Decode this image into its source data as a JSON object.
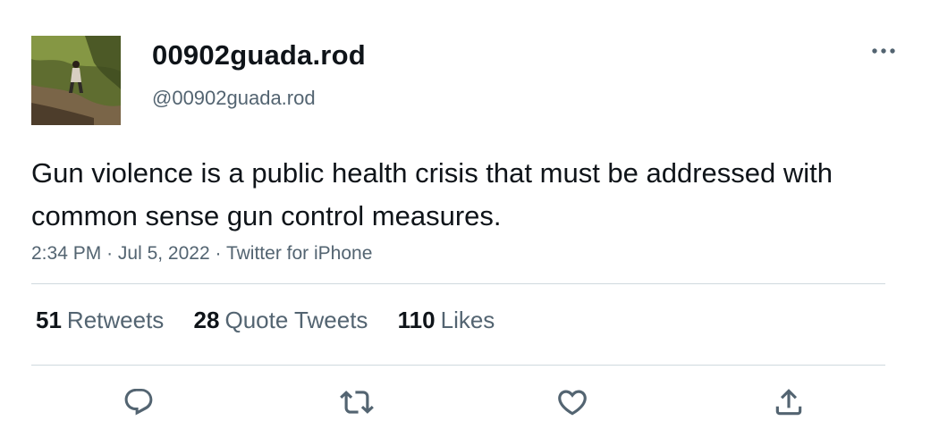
{
  "author": {
    "display_name": "00902guada.rod",
    "handle": "@00902guada.rod",
    "avatar_icon": "profile-photo-person-on-trail"
  },
  "tweet": {
    "text": "Gun violence is a public health crisis that must be addressed with common sense gun control measures.",
    "time": "2:34 PM",
    "date": "Jul 5, 2022",
    "source": "Twitter for iPhone",
    "separator": "·"
  },
  "stats": {
    "retweets_count": "51",
    "retweets_label": "Retweets",
    "quotes_count": "28",
    "quotes_label": "Quote Tweets",
    "likes_count": "110",
    "likes_label": "Likes"
  },
  "actions": {
    "icons": [
      "reply-icon",
      "retweet-icon",
      "like-icon",
      "share-icon"
    ]
  },
  "colors": {
    "text_primary": "#0f1419",
    "text_secondary": "#536471",
    "divider": "#cfd9de",
    "icon": "#536471"
  }
}
